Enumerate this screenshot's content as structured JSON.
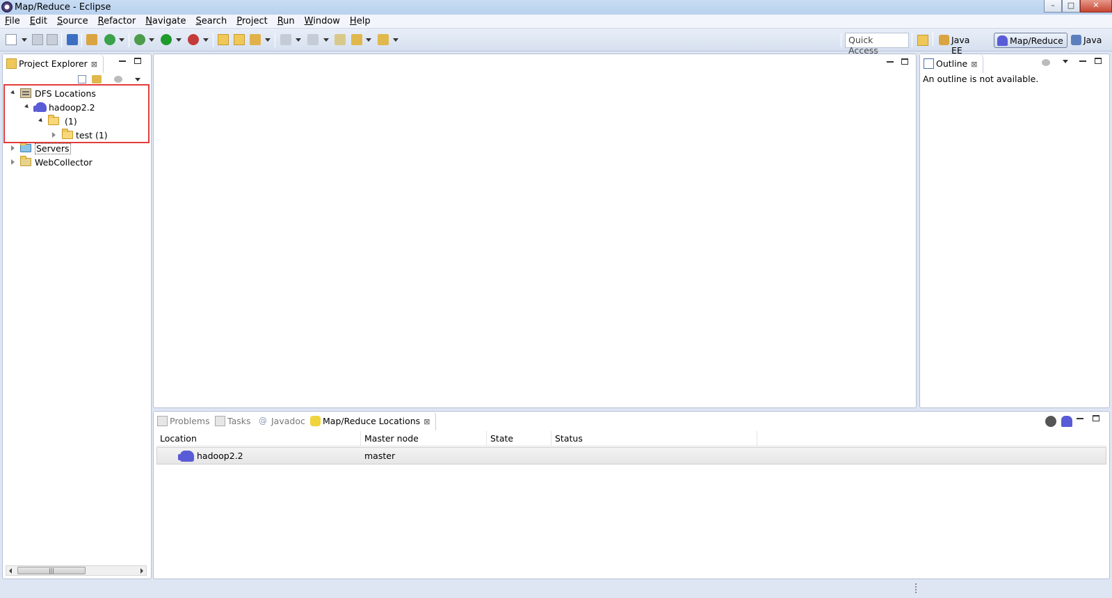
{
  "window": {
    "title": "Map/Reduce - Eclipse",
    "controls": {
      "minimize": "–",
      "maximize": "□",
      "close": "✕"
    }
  },
  "menu": {
    "items": [
      "File",
      "Edit",
      "Source",
      "Refactor",
      "Navigate",
      "Search",
      "Project",
      "Run",
      "Window",
      "Help"
    ]
  },
  "toolbar": {
    "quick_access_placeholder": "Quick Access"
  },
  "perspectives": {
    "items": [
      {
        "label": "Java EE",
        "icon": "java-ee-icon"
      },
      {
        "label": "Map/Reduce",
        "icon": "elephant-icon",
        "active": true
      },
      {
        "label": "Java",
        "icon": "java-icon"
      }
    ]
  },
  "project_explorer": {
    "tab_label": "Project Explorer",
    "tree": {
      "dfs_locations": "DFS Locations",
      "hadoop": "hadoop2.2",
      "root_folder": "(1)",
      "test_folder": "test (1)",
      "servers": "Servers",
      "webcollector": "WebCollector"
    }
  },
  "outline": {
    "tab_label": "Outline",
    "message": "An outline is not available."
  },
  "bottom_panel": {
    "tabs": [
      {
        "label": "Problems"
      },
      {
        "label": "Tasks"
      },
      {
        "label": "Javadoc"
      },
      {
        "label": "Map/Reduce Locations",
        "active": true
      }
    ],
    "columns": [
      "Location",
      "Master node",
      "State",
      "Status"
    ],
    "rows": [
      {
        "location": "hadoop2.2",
        "master_node": "master",
        "state": "",
        "status": ""
      }
    ]
  },
  "colors": {
    "highlight_box": "#e33b3b",
    "accent": "#5a5bd6"
  }
}
